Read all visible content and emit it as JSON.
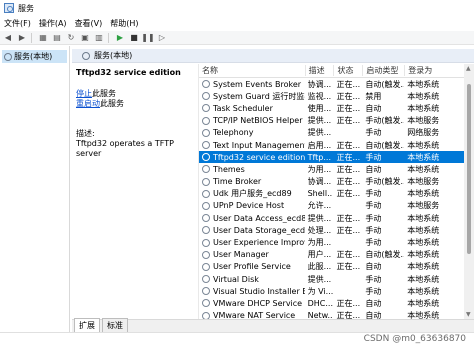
{
  "window": {
    "title": "服务"
  },
  "menu": [
    "文件(F)",
    "操作(A)",
    "查看(V)",
    "帮助(H)"
  ],
  "tree": {
    "root_label": "服务(本地)"
  },
  "right_header": {
    "label": "服务(本地)"
  },
  "detail": {
    "service_name": "Tftpd32 service edition",
    "stop_link": "停止",
    "stop_suffix": "此服务",
    "restart_link": "重启动",
    "restart_suffix": "此服务",
    "desc_label": "描述:",
    "desc_text": "Tftpd32 operates a TFTP server"
  },
  "grid": {
    "headers": [
      "名称",
      "描述",
      "状态",
      "启动类型",
      "登录为"
    ],
    "rows": [
      {
        "name": "System Events Broker",
        "desc": "协调...",
        "status": "正在...",
        "startup": "自动(触发...",
        "logon": "本地系统"
      },
      {
        "name": "System Guard 运行时监视...",
        "desc": "监视...",
        "status": "正在...",
        "startup": "禁用",
        "logon": "本地系统"
      },
      {
        "name": "Task Scheduler",
        "desc": "使用...",
        "status": "正在...",
        "startup": "自动",
        "logon": "本地系统"
      },
      {
        "name": "TCP/IP NetBIOS Helper",
        "desc": "提供...",
        "status": "正在...",
        "startup": "手动(触发...",
        "logon": "本地服务"
      },
      {
        "name": "Telephony",
        "desc": "提供...",
        "status": "",
        "startup": "手动",
        "logon": "网络服务"
      },
      {
        "name": "Text Input Management ...",
        "desc": "启用...",
        "status": "正在...",
        "startup": "自动(触发...",
        "logon": "本地系统"
      },
      {
        "name": "Tftpd32 service edition",
        "desc": "Tftp...",
        "status": "正在...",
        "startup": "手动",
        "logon": "本地系统",
        "selected": true
      },
      {
        "name": "Themes",
        "desc": "为用...",
        "status": "正在...",
        "startup": "自动",
        "logon": "本地系统"
      },
      {
        "name": "Time Broker",
        "desc": "协调...",
        "status": "正在...",
        "startup": "手动(触发...",
        "logon": "本地服务"
      },
      {
        "name": "Udk 用户服务_ecd89",
        "desc": "Shell...",
        "status": "正在...",
        "startup": "手动",
        "logon": "本地系统"
      },
      {
        "name": "UPnP Device Host",
        "desc": "允许...",
        "status": "",
        "startup": "手动",
        "logon": "本地服务"
      },
      {
        "name": "User Data Access_ecd89",
        "desc": "提供...",
        "status": "正在...",
        "startup": "手动",
        "logon": "本地系统"
      },
      {
        "name": "User Data Storage_ecd89",
        "desc": "处理...",
        "status": "正在...",
        "startup": "手动",
        "logon": "本地系统"
      },
      {
        "name": "User Experience Improve...",
        "desc": "为用...",
        "status": "",
        "startup": "手动",
        "logon": "本地系统"
      },
      {
        "name": "User Manager",
        "desc": "用户...",
        "status": "正在...",
        "startup": "自动(触发...",
        "logon": "本地系统"
      },
      {
        "name": "User Profile Service",
        "desc": "此服...",
        "status": "正在...",
        "startup": "自动",
        "logon": "本地系统"
      },
      {
        "name": "Virtual Disk",
        "desc": "提供...",
        "status": "",
        "startup": "手动",
        "logon": "本地系统"
      },
      {
        "name": "Visual Studio Installer Ele...",
        "desc": "为 Vi...",
        "status": "",
        "startup": "手动",
        "logon": "本地系统"
      },
      {
        "name": "VMware DHCP Service",
        "desc": "DHC...",
        "status": "正在...",
        "startup": "自动",
        "logon": "本地系统"
      },
      {
        "name": "VMware NAT Service",
        "desc": "Netw...",
        "status": "正在...",
        "startup": "自动",
        "logon": "本地系统"
      }
    ]
  },
  "tabs": [
    "扩展",
    "标准"
  ],
  "watermark": "CSDN @m0_63636870",
  "colors": {
    "selection": "#0078d7",
    "link": "#0b50d0"
  },
  "icons": [
    "services-app-icon",
    "back-icon",
    "forward-icon",
    "console-tree-icon",
    "refresh-icon",
    "export-icon",
    "help-icon",
    "properties-icon",
    "start-icon",
    "stop-icon",
    "pause-icon",
    "restart-icon",
    "gear-icon"
  ]
}
